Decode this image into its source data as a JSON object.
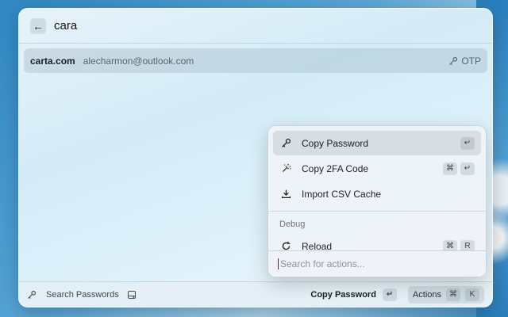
{
  "search": {
    "query": "cara"
  },
  "results": [
    {
      "title": "carta.com",
      "subtitle": "alecharmon@outlook.com",
      "accessory": "OTP"
    }
  ],
  "action_panel": {
    "actions": [
      {
        "label": "Copy Password",
        "icon": "key-icon",
        "keys": [
          "↵"
        ]
      },
      {
        "label": "Copy 2FA Code",
        "icon": "magic-wand-icon",
        "keys": [
          "⌘",
          "↵"
        ]
      },
      {
        "label": "Import CSV Cache",
        "icon": "download-icon",
        "keys": []
      }
    ],
    "section_title": "Debug",
    "debug_actions": [
      {
        "label": "Reload",
        "icon": "reload-icon",
        "keys": [
          "⌘",
          "R"
        ]
      }
    ],
    "search_placeholder": "Search for actions..."
  },
  "footer": {
    "navigation_title": "Search Passwords",
    "primary_action": "Copy Password",
    "primary_key": "↵",
    "actions_label": "Actions",
    "actions_keys": [
      "⌘",
      "K"
    ]
  }
}
